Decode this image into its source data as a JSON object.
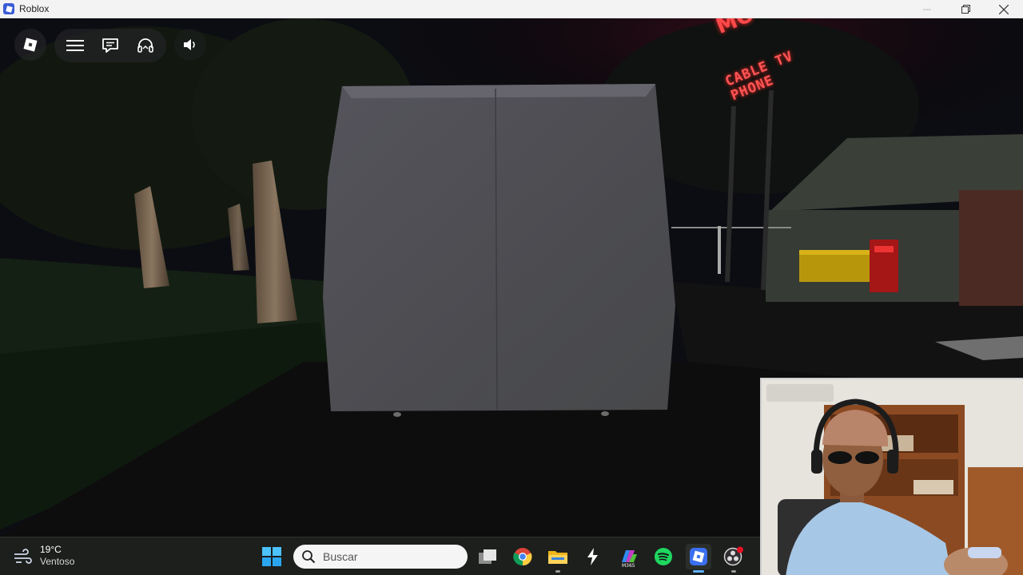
{
  "window": {
    "title": "Roblox",
    "app_icon": "roblox-icon",
    "controls": [
      "minimize-icon",
      "restore-icon",
      "close-icon"
    ]
  },
  "game": {
    "sign_text": [
      "MO",
      "CABLE TV",
      "PHONE"
    ],
    "sign_color": "#ff3b3b",
    "hud": {
      "roblox_menu_icon": "roblox-logo-icon",
      "menu_icon": "hamburger-menu-icon",
      "chat_icon": "chat-icon",
      "voice_icon": "headset-icon",
      "volume_icon": "speaker-icon"
    }
  },
  "taskbar": {
    "weather": {
      "temperature": "19°C",
      "condition": "Ventoso",
      "icon": "wind-icon"
    },
    "start_icon": "windows-start-icon",
    "search": {
      "placeholder": "Buscar",
      "icon": "search-icon"
    },
    "apps": [
      {
        "name": "task-view-icon"
      },
      {
        "name": "chrome-icon"
      },
      {
        "name": "file-explorer-icon"
      },
      {
        "name": "bolt-app-icon"
      },
      {
        "name": "m365-icon",
        "label": "M365"
      },
      {
        "name": "spotify-icon"
      },
      {
        "name": "roblox-icon",
        "active": true
      },
      {
        "name": "obs-icon"
      }
    ],
    "accent": "#5fb2ff"
  },
  "webcam": {
    "description_icon": "webcam-feed"
  }
}
